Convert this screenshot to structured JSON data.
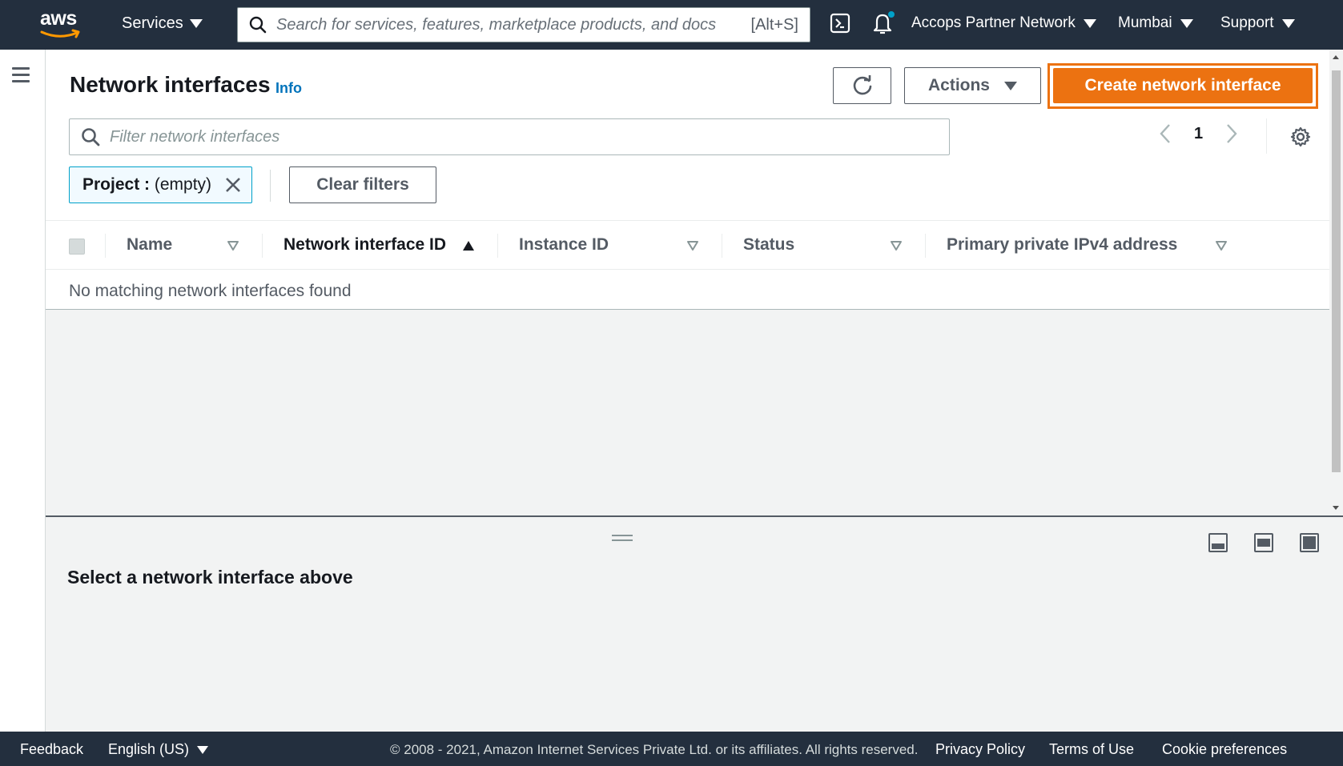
{
  "topnav": {
    "logo_text": "aws",
    "services_label": "Services",
    "search_placeholder": "Search for services, features, marketplace products, and docs",
    "search_hint": "[Alt+S]",
    "account_label": "Accops Partner Network",
    "region_label": "Mumbai",
    "support_label": "Support"
  },
  "page": {
    "title": "Network interfaces",
    "info_link": "Info",
    "actions_label": "Actions",
    "create_label": "Create network interface",
    "filter_placeholder": "Filter network interfaces",
    "page_number": "1",
    "token": {
      "key": "Project :",
      "value": "(empty)"
    },
    "clear_filters_label": "Clear filters"
  },
  "table": {
    "columns": [
      {
        "label": "Name",
        "sort": "none"
      },
      {
        "label": "Network interface ID",
        "sort": "ascending"
      },
      {
        "label": "Instance ID",
        "sort": "none"
      },
      {
        "label": "Status",
        "sort": "none"
      },
      {
        "label": "Primary private IPv4 address",
        "sort": "none"
      }
    ],
    "empty_message": "No matching network interfaces found"
  },
  "details": {
    "title": "Select a network interface above"
  },
  "footer": {
    "feedback": "Feedback",
    "language": "English (US)",
    "copyright": "© 2008 - 2021, Amazon Internet Services Private Ltd. or its affiliates. All rights reserved.",
    "privacy": "Privacy Policy",
    "terms": "Terms of Use",
    "cookies": "Cookie preferences"
  },
  "colors": {
    "nav_bg": "#232f3e",
    "primary_orange": "#ec7211",
    "link_blue": "#0073bb"
  }
}
